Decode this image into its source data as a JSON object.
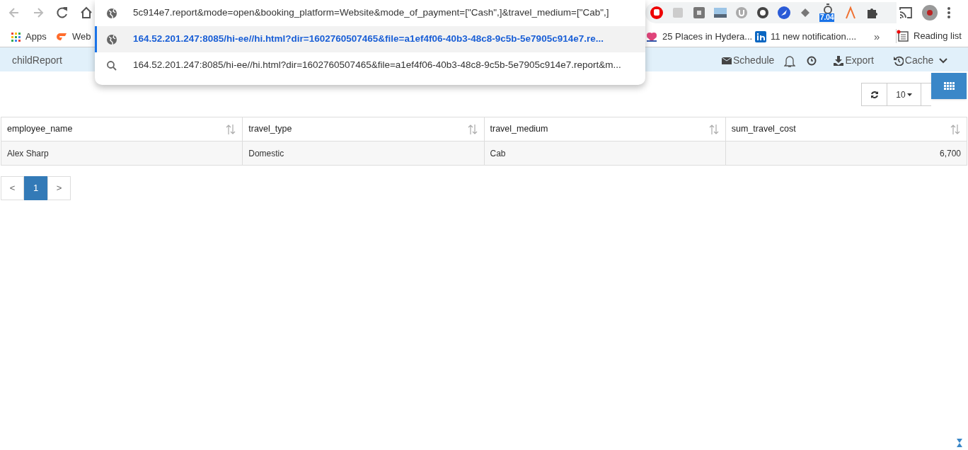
{
  "browser": {
    "omnibox_suggestions": [
      {
        "kind": "globe",
        "text": "5c914e7.report&mode=open&booking_platform=Website&mode_of_payment=[\"Cash\",]&travel_medium=[\"Cab\",]",
        "selected": false
      },
      {
        "kind": "globe",
        "text": "164.52.201.247:8085/hi-ee//hi.html?dir=1602760507465&file=a1ef4f06-40b3-48c8-9c5b-5e7905c914e7.re...",
        "selected": true
      },
      {
        "kind": "search",
        "text": "164.52.201.247:8085/hi-ee//hi.html?dir=1602760507465&file=a1ef4f06-40b3-48c8-9c5b-5e7905c914e7.report&m...",
        "selected": false
      }
    ],
    "extension_badge": "7.04",
    "bookmarks": [
      {
        "label": "Apps",
        "kind": "apps"
      },
      {
        "label": "Web",
        "kind": "cpanel"
      },
      {
        "label": "25 Places in Hydera...",
        "kind": "hearts"
      },
      {
        "label": "11 new notification....",
        "kind": "linkedin"
      }
    ],
    "bookmarks_overflow": "»",
    "reading_list": "Reading list"
  },
  "app": {
    "title": "childReport",
    "actions": [
      {
        "kind": "schedule",
        "label": "Schedule"
      },
      {
        "kind": "bell"
      },
      {
        "kind": "clock"
      },
      {
        "kind": "export",
        "label": "Export"
      },
      {
        "kind": "cache",
        "label": "Cache"
      }
    ],
    "page_size": "10",
    "table": {
      "columns": [
        "employee_name",
        "travel_type",
        "travel_medium",
        "sum_travel_cost"
      ],
      "rows": [
        [
          "Alex Sharp",
          "Domestic",
          "Cab",
          "6,700"
        ]
      ]
    },
    "pagination": {
      "prev": "<",
      "pages": [
        {
          "label": "1",
          "selected": true
        }
      ],
      "next": ">"
    }
  }
}
